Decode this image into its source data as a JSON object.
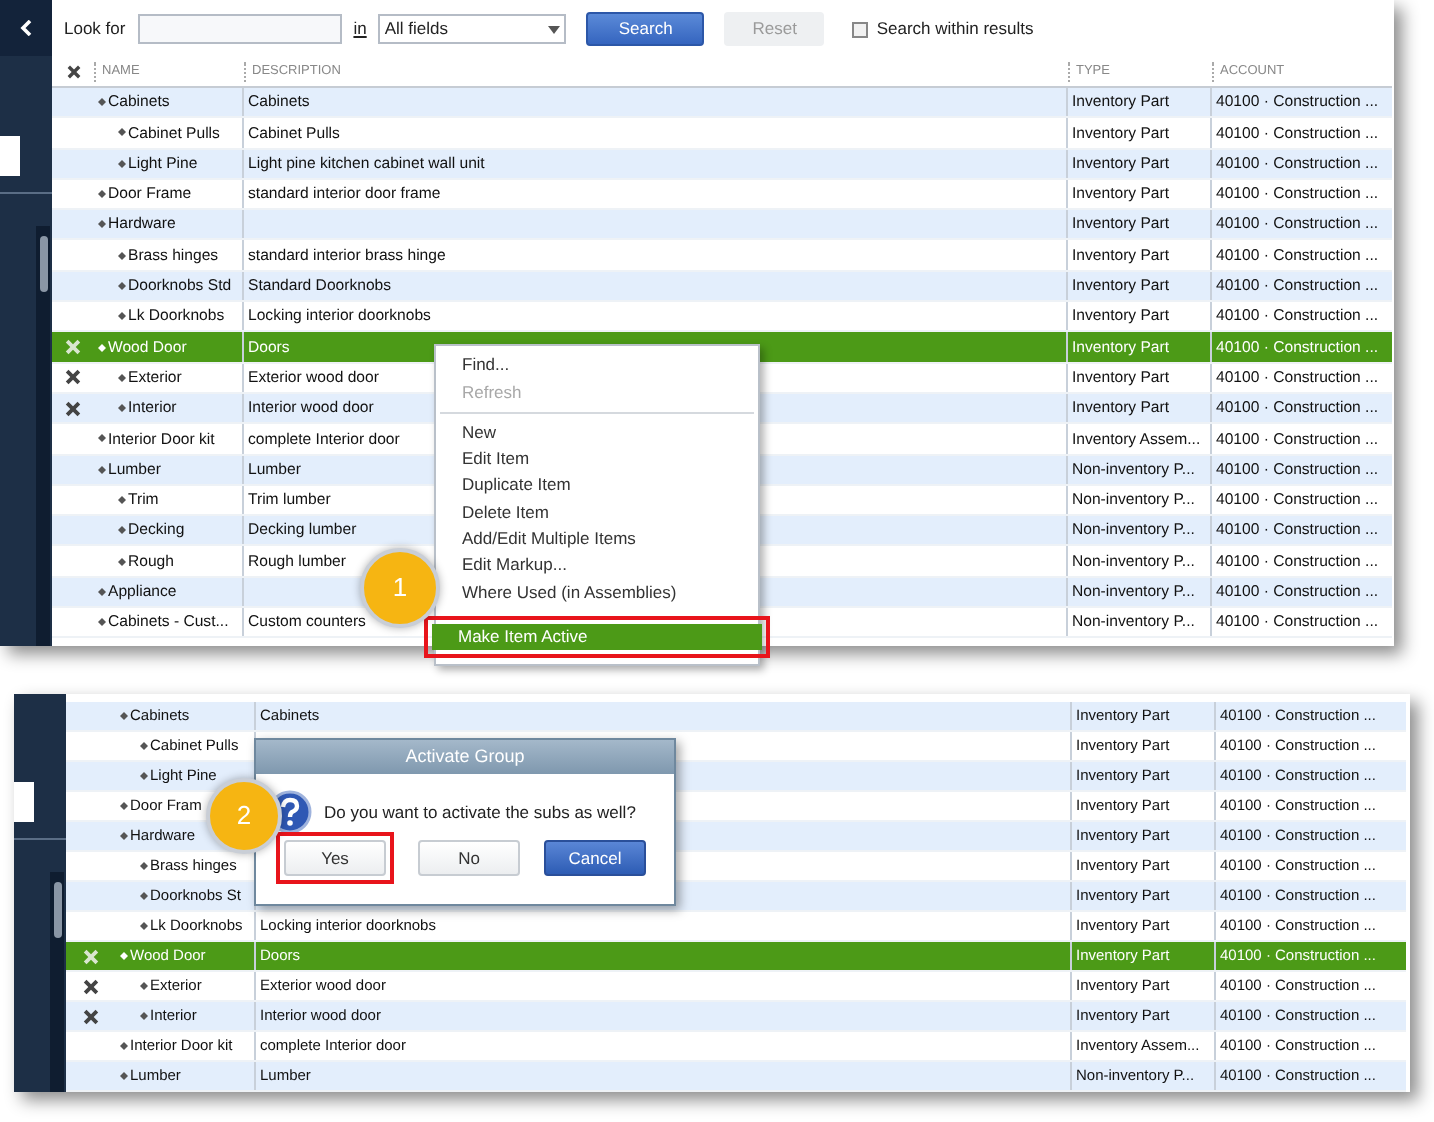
{
  "search_bar": {
    "look_for_label": "Look for",
    "in_label": "in",
    "field_select": "All fields",
    "search_button": "Search",
    "reset_button": "Reset",
    "reset_disabled": true,
    "within_results": {
      "label": "Search within results",
      "checked": false
    }
  },
  "columns": [
    "NAME",
    "DESCRIPTION",
    "TYPE",
    "ACCOUNT"
  ],
  "items": [
    {
      "name": "Cabinets",
      "description": "Cabinets",
      "type": "Inventory Part",
      "account": "40100 · Construction ...",
      "inactive": false,
      "selected": false,
      "children": [
        {
          "name": "Cabinet Pulls",
          "description": "Cabinet Pulls",
          "type": "Inventory Part",
          "account": "40100 · Construction ...",
          "inactive": false,
          "selected": false
        },
        {
          "name": "Light Pine",
          "description": "Light pine kitchen cabinet wall unit",
          "type": "Inventory Part",
          "account": "40100 · Construction ...",
          "inactive": false,
          "selected": false
        }
      ]
    },
    {
      "name": "Door Frame",
      "description": "standard interior door frame",
      "type": "Inventory Part",
      "account": "40100 · Construction ...",
      "inactive": false,
      "selected": false
    },
    {
      "name": "Hardware",
      "type": "Inventory Part",
      "account": "40100 · Construction ...",
      "inactive": false,
      "selected": false,
      "children": [
        {
          "name": "Brass hinges",
          "description": "standard interior brass hinge",
          "type": "Inventory Part",
          "account": "40100 · Construction ...",
          "inactive": false,
          "selected": false
        },
        {
          "name": "Doorknobs Std",
          "description": "Standard Doorknobs",
          "type": "Inventory Part",
          "account": "40100 · Construction ...",
          "inactive": false,
          "selected": false
        },
        {
          "name": "Lk Doorknobs",
          "description": "Locking interior doorknobs",
          "type": "Inventory Part",
          "account": "40100 · Construction ...",
          "inactive": false,
          "selected": false
        }
      ]
    },
    {
      "name": "Wood Door",
      "description": "Doors",
      "type": "Inventory Part",
      "account": "40100 · Construction ...",
      "inactive": true,
      "selected": true,
      "children": [
        {
          "name": "Exterior",
          "description": "Exterior wood door",
          "type": "Inventory Part",
          "account": "40100 · Construction ...",
          "inactive": true,
          "selected": false
        },
        {
          "name": "Interior",
          "description": "Interior wood door",
          "type": "Inventory Part",
          "account": "40100 · Construction ...",
          "inactive": true,
          "selected": false
        }
      ]
    },
    {
      "name": "Interior Door kit",
      "description": "complete Interior door",
      "type": "Inventory Assem...",
      "account": "40100 · Construction ...",
      "inactive": false,
      "selected": false
    },
    {
      "name": "Lumber",
      "description": "Lumber",
      "type": "Non-inventory P...",
      "account": "40100 · Construction ...",
      "inactive": false,
      "selected": false,
      "children": [
        {
          "name": "Trim",
          "description": "Trim lumber",
          "type": "Non-inventory P...",
          "account": "40100 · Construction ...",
          "inactive": false,
          "selected": false
        },
        {
          "name": "Decking",
          "description": "Decking lumber",
          "type": "Non-inventory P...",
          "account": "40100 · Construction ...",
          "inactive": false,
          "selected": false
        },
        {
          "name": "Rough",
          "description": "Rough lumber",
          "type": "Non-inventory P...",
          "account": "40100 · Construction ...",
          "inactive": false,
          "selected": false
        }
      ]
    },
    {
      "name": "Appliance",
      "type": "Non-inventory P...",
      "account": "40100 · Construction ...",
      "inactive": false,
      "selected": false
    },
    {
      "name": "Cabinets - Cust...",
      "description": "Custom counters",
      "type": "Non-inventory P...",
      "account": "40100 · Construction ...",
      "inactive": false,
      "selected": false
    }
  ],
  "context_menu": {
    "items": [
      {
        "kind": "item",
        "label": "Find...",
        "disabled": false,
        "selected": false,
        "highlighted": false
      },
      {
        "kind": "item",
        "label": "Refresh",
        "disabled": true,
        "selected": false,
        "highlighted": false
      },
      {
        "kind": "separator"
      },
      {
        "kind": "item",
        "label": "New",
        "disabled": false,
        "selected": false,
        "highlighted": false
      },
      {
        "kind": "item",
        "label": "Edit Item",
        "disabled": false,
        "selected": false,
        "highlighted": false
      },
      {
        "kind": "item",
        "label": "Duplicate Item",
        "disabled": false,
        "selected": false,
        "highlighted": false
      },
      {
        "kind": "item",
        "label": "Delete Item",
        "disabled": false,
        "selected": false,
        "highlighted": false
      },
      {
        "kind": "item",
        "label": "Add/Edit Multiple Items",
        "disabled": false,
        "selected": false,
        "highlighted": false
      },
      {
        "kind": "item",
        "label": "Edit Markup...",
        "disabled": false,
        "selected": false,
        "highlighted": false
      },
      {
        "kind": "item",
        "label": "Where Used (in Assemblies)",
        "disabled": false,
        "selected": false,
        "highlighted": false
      },
      {
        "kind": "item",
        "label": "Make Item Active",
        "disabled": false,
        "selected": true,
        "highlighted": true
      }
    ]
  },
  "step_1_badge": "1",
  "second_view": {
    "items": [
      {
        "name": "Cabinets",
        "description": "Cabinets",
        "type": "Inventory Part",
        "account": "40100 · Construction ...",
        "inactive": false,
        "selected": false,
        "children": [
          {
            "name": "Cabinet Pulls",
            "type": "Inventory Part",
            "account": "40100 · Construction ...",
            "inactive": false,
            "selected": false
          },
          {
            "name": "Light Pine",
            "type": "Inventory Part",
            "account": "40100 · Construction ...",
            "inactive": false,
            "selected": false
          }
        ]
      },
      {
        "name": "Door Fram",
        "type": "Inventory Part",
        "account": "40100 · Construction ...",
        "inactive": false,
        "selected": false
      },
      {
        "name": "Hardware",
        "type": "Inventory Part",
        "account": "40100 · Construction ...",
        "inactive": false,
        "selected": false,
        "children": [
          {
            "name": "Brass hinges",
            "type": "Inventory Part",
            "account": "40100 · Construction ...",
            "inactive": false,
            "selected": false
          },
          {
            "name": "Doorknobs St",
            "type": "Inventory Part",
            "account": "40100 · Construction ...",
            "inactive": false,
            "selected": false
          },
          {
            "name": "Lk Doorknobs",
            "description": "Locking interior doorknobs",
            "type": "Inventory Part",
            "account": "40100 · Construction ...",
            "inactive": false,
            "selected": false
          }
        ]
      },
      {
        "name": "Wood Door",
        "description": "Doors",
        "type": "Inventory Part",
        "account": "40100 · Construction ...",
        "inactive": true,
        "selected": true,
        "children": [
          {
            "name": "Exterior",
            "description": "Exterior wood door",
            "type": "Inventory Part",
            "account": "40100 · Construction ...",
            "inactive": true,
            "selected": false
          },
          {
            "name": "Interior",
            "description": "Interior wood door",
            "type": "Inventory Part",
            "account": "40100 · Construction ...",
            "inactive": true,
            "selected": false
          }
        ]
      },
      {
        "name": "Interior Door kit",
        "description": "complete Interior door",
        "type": "Inventory Assem...",
        "account": "40100 · Construction ...",
        "inactive": false,
        "selected": false
      },
      {
        "name": "Lumber",
        "description": "Lumber",
        "type": "Non-inventory P...",
        "account": "40100 · Construction ...",
        "inactive": false,
        "selected": false
      }
    ],
    "dialog": {
      "title": "Activate Group",
      "message": "Do you want to activate the subs as well?",
      "buttons": [
        {
          "label": "Yes",
          "default": false,
          "highlighted": true
        },
        {
          "label": "No",
          "default": false,
          "highlighted": false
        },
        {
          "label": "Cancel",
          "default": true,
          "highlighted": false
        }
      ]
    },
    "step_2_badge": "2"
  }
}
